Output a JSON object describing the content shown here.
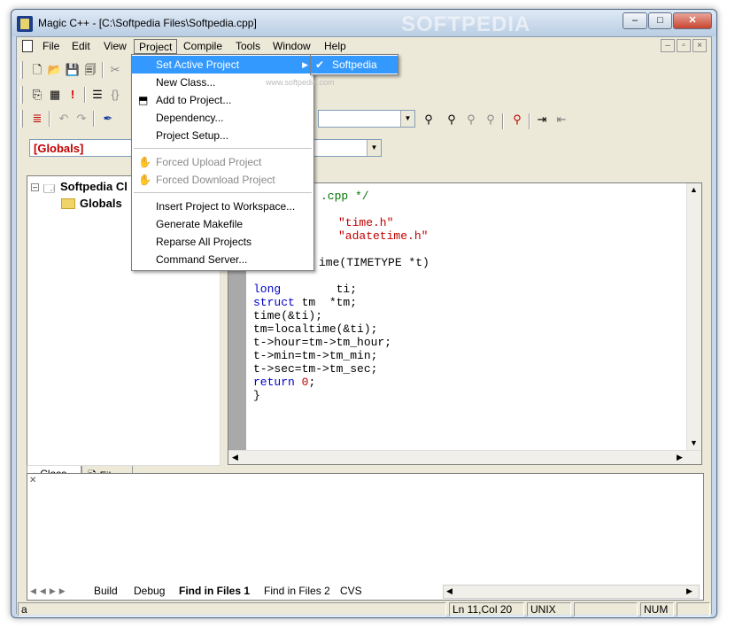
{
  "window": {
    "title": "Magic C++ - [C:\\Softpedia Files\\Softpedia.cpp]",
    "watermark": "SOFTPEDIA"
  },
  "caption_buttons": {
    "minimize": "–",
    "maximize": "□",
    "close": "✕"
  },
  "menubar": {
    "items": [
      "File",
      "Edit",
      "View",
      "Project",
      "Compile",
      "Tools",
      "Window",
      "Help"
    ],
    "active": "Project"
  },
  "mdi_buttons": {
    "minimize": "–",
    "restore": "▫",
    "close": "×"
  },
  "combos": {
    "scope": "[Globals]",
    "find": ""
  },
  "class_tree": {
    "root": "Softpedia Cl",
    "child": "Globals"
  },
  "panel_tabs": [
    "Class",
    "Files"
  ],
  "editor": {
    "lines": [
      {
        "parts": [
          {
            "t": ".cpp */",
            "c": "cmt"
          }
        ]
      },
      {
        "parts": []
      },
      {
        "parts": [
          {
            "t": "\"time.h\"",
            "c": "str"
          }
        ]
      },
      {
        "parts": [
          {
            "t": "\"adatetime.h\"",
            "c": "str"
          }
        ]
      },
      {
        "parts": []
      },
      {
        "parts": [
          {
            "t": "ime(TIMETYPE *t)",
            "c": ""
          }
        ]
      },
      {
        "parts": []
      },
      {
        "parts": [
          {
            "t": "long",
            "c": "kw"
          },
          {
            "t": "        ti;",
            "c": ""
          }
        ]
      },
      {
        "parts": [
          {
            "t": "struct",
            "c": "kw"
          },
          {
            "t": " tm  *tm;",
            "c": ""
          }
        ]
      },
      {
        "parts": [
          {
            "t": "time(&ti);",
            "c": ""
          }
        ]
      },
      {
        "parts": [
          {
            "t": "tm=localtime(&ti);",
            "c": ""
          }
        ]
      },
      {
        "parts": [
          {
            "t": "t->hour=tm->tm_hour;",
            "c": ""
          }
        ]
      },
      {
        "parts": [
          {
            "t": "t->min=tm->tm_min;",
            "c": ""
          }
        ]
      },
      {
        "parts": [
          {
            "t": "t->sec=tm->tm_sec;",
            "c": ""
          }
        ]
      },
      {
        "parts": [
          {
            "t": "return",
            "c": "kw"
          },
          {
            "t": " ",
            "c": ""
          },
          {
            "t": "0",
            "c": "str"
          },
          {
            "t": ";",
            "c": ""
          }
        ]
      },
      {
        "parts": [
          {
            "t": "}",
            "c": ""
          }
        ]
      }
    ]
  },
  "output_tabs": [
    "Build",
    "Debug",
    "Find in Files 1",
    "Find in Files 2",
    "CVS"
  ],
  "output_selected": "Find in Files 1",
  "status": {
    "left": "a",
    "position": "Ln 11,Col 20",
    "format": "UNIX",
    "numlock": "NUM"
  },
  "project_menu": {
    "items": [
      {
        "label": "Set Active Project",
        "submenu": true,
        "highlight": true
      },
      {
        "label": "New Class..."
      },
      {
        "label": "Add to Project..."
      },
      {
        "label": "Dependency..."
      },
      {
        "label": "Project Setup..."
      },
      {
        "sep": true
      },
      {
        "label": "Forced Upload Project",
        "disabled": true
      },
      {
        "label": "Forced Download Project",
        "disabled": true
      },
      {
        "sep": true
      },
      {
        "label": "Insert Project to Workspace..."
      },
      {
        "label": "Generate Makefile"
      },
      {
        "label": "Reparse All Projects"
      },
      {
        "label": "Command Server..."
      }
    ]
  },
  "submenu": {
    "item": "Softpedia",
    "checked": true
  },
  "submenu_watermark": "www.softpedia.com"
}
